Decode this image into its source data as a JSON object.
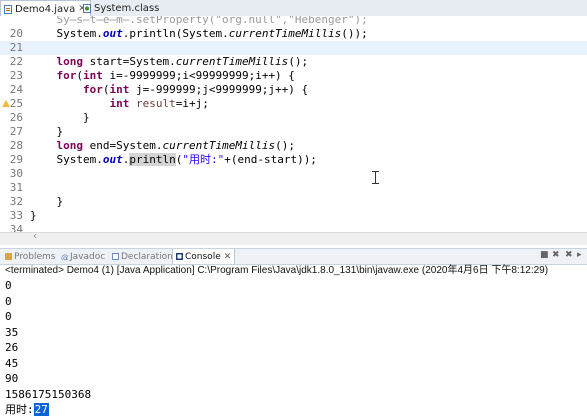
{
  "editor_tabs": [
    {
      "label": "Demo4.java",
      "close": "✕"
    },
    {
      "label": "System.class"
    }
  ],
  "code_lines": [
    {
      "num": "",
      "parts": [
        {
          "t": "    Sy̶s̶t̶e̶m̶.setProperty(\"org.null\",\"Hebenger\");",
          "c": "gray"
        }
      ]
    },
    {
      "num": "20",
      "parts": [
        {
          "t": "    System."
        },
        {
          "t": "out",
          "c": "fld"
        },
        {
          "t": ".println(System."
        },
        {
          "t": "currentTimeMillis",
          "c": "sm"
        },
        {
          "t": "());"
        }
      ]
    },
    {
      "num": "21",
      "parts": [
        {
          "t": ""
        }
      ]
    },
    {
      "num": "22",
      "parts": [
        {
          "t": "    "
        },
        {
          "t": "long",
          "c": "kw"
        },
        {
          "t": " start=System."
        },
        {
          "t": "currentTimeMillis",
          "c": "sm"
        },
        {
          "t": "();"
        }
      ]
    },
    {
      "num": "23",
      "parts": [
        {
          "t": "    "
        },
        {
          "t": "for",
          "c": "kw"
        },
        {
          "t": "("
        },
        {
          "t": "int",
          "c": "kw"
        },
        {
          "t": " i=-9999999;i<99999999;i++) {"
        }
      ]
    },
    {
      "num": "24",
      "parts": [
        {
          "t": "        "
        },
        {
          "t": "for",
          "c": "kw"
        },
        {
          "t": "("
        },
        {
          "t": "int",
          "c": "kw"
        },
        {
          "t": " j=-999999;j<9999999;j++) {"
        }
      ]
    },
    {
      "num": "25",
      "parts": [
        {
          "t": "            "
        },
        {
          "t": "int",
          "c": "kw"
        },
        {
          "t": " "
        },
        {
          "t": "result",
          "c": "loc"
        },
        {
          "t": "=i+j;"
        }
      ]
    },
    {
      "num": "26",
      "parts": [
        {
          "t": "        }"
        }
      ]
    },
    {
      "num": "27",
      "parts": [
        {
          "t": "    }"
        }
      ]
    },
    {
      "num": "28",
      "parts": [
        {
          "t": "    "
        },
        {
          "t": "long",
          "c": "kw"
        },
        {
          "t": " end=System."
        },
        {
          "t": "currentTimeMillis",
          "c": "sm"
        },
        {
          "t": "();"
        }
      ]
    },
    {
      "num": "29",
      "parts": [
        {
          "t": "    System."
        },
        {
          "t": "out",
          "c": "fld"
        },
        {
          "t": "."
        },
        {
          "t": "println",
          "c": "hl"
        },
        {
          "t": "("
        },
        {
          "t": "\"用时:\"",
          "c": "str"
        },
        {
          "t": "+(end-start));"
        }
      ]
    },
    {
      "num": "30",
      "parts": [
        {
          "t": ""
        }
      ]
    },
    {
      "num": "31",
      "parts": [
        {
          "t": ""
        }
      ]
    },
    {
      "num": "32",
      "parts": [
        {
          "t": "    }"
        }
      ]
    },
    {
      "num": "33",
      "parts": [
        {
          "t": "}"
        }
      ]
    },
    {
      "num": "34",
      "parts": [
        {
          "t": ""
        }
      ]
    }
  ],
  "view_tabs": [
    {
      "label": "Problems"
    },
    {
      "label": "Javadoc"
    },
    {
      "label": "Declaration"
    },
    {
      "label": "Console",
      "close": "✕"
    }
  ],
  "console": {
    "header": "<terminated> Demo4 (1) [Java Application] C:\\Program Files\\Java\\jdk1.8.0_131\\bin\\javaw.exe (2020年4月6日 下午8:12:29)",
    "lines": [
      "0",
      "0",
      "0",
      "35",
      "26",
      "45",
      "90",
      "1586175150368"
    ],
    "last_label": "用时:",
    "last_value": "27"
  },
  "colors": {
    "keyword": "#7f0055",
    "field": "#0000c0",
    "string": "#2a00ff",
    "selection": "#0a64d8"
  }
}
